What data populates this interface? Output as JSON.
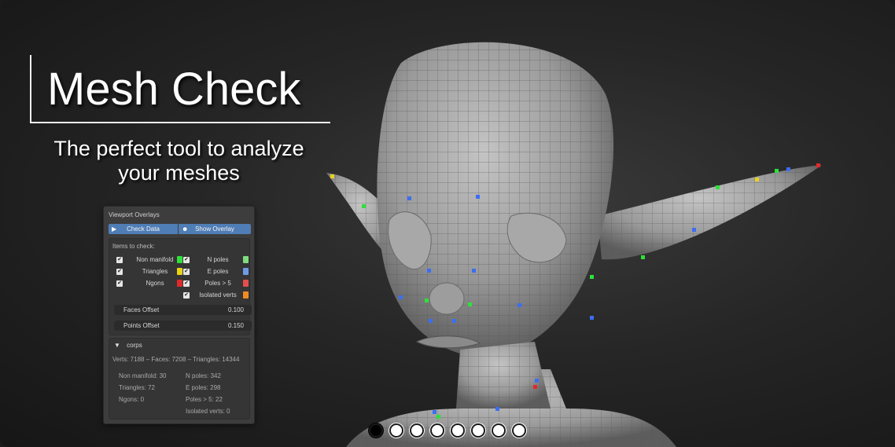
{
  "headline": {
    "title": "Mesh Check",
    "subtitle": "The perfect tool to analyze your meshes"
  },
  "panel": {
    "header": "Viewport Overlays",
    "check_data_label": "Check Data",
    "show_overlay_label": "Show Overlay",
    "items_title": "Items to check:",
    "left_items": [
      {
        "label": "Non manifold",
        "checked": true,
        "color": "#2ee03a"
      },
      {
        "label": "Triangles",
        "checked": true,
        "color": "#e8d21a"
      },
      {
        "label": "Ngons",
        "checked": true,
        "color": "#e02a2a"
      }
    ],
    "right_items": [
      {
        "label": "N poles",
        "checked": true,
        "color": "#7fdc7f"
      },
      {
        "label": "E poles",
        "checked": true,
        "color": "#6f9be6"
      },
      {
        "label": "Poles > 5",
        "checked": true,
        "color": "#e44e4e"
      },
      {
        "label": "Isolated verts",
        "checked": true,
        "color": "#f08a24"
      }
    ],
    "faces_offset": {
      "label": "Faces Offset",
      "value": "0.100"
    },
    "points_offset": {
      "label": "Points Offset",
      "value": "0.150"
    },
    "object_name": "corps",
    "summary": "Verts: 7188 – Faces: 7208 – Triangles: 14344",
    "stats_left": [
      "Non manifold: 30",
      "Triangles: 72",
      "Ngons: 0"
    ],
    "stats_right": [
      "N poles: 342",
      "E poles: 298",
      "Poles > 5: 22",
      "Isolated verts: 0"
    ]
  },
  "pager": {
    "count": 8,
    "active": 0
  },
  "colors": {
    "accent_button": "#4f7db6",
    "mesh": "#9a9a9a",
    "pole_blue": "#3b6ef2",
    "pole_green": "#2ee03a"
  }
}
